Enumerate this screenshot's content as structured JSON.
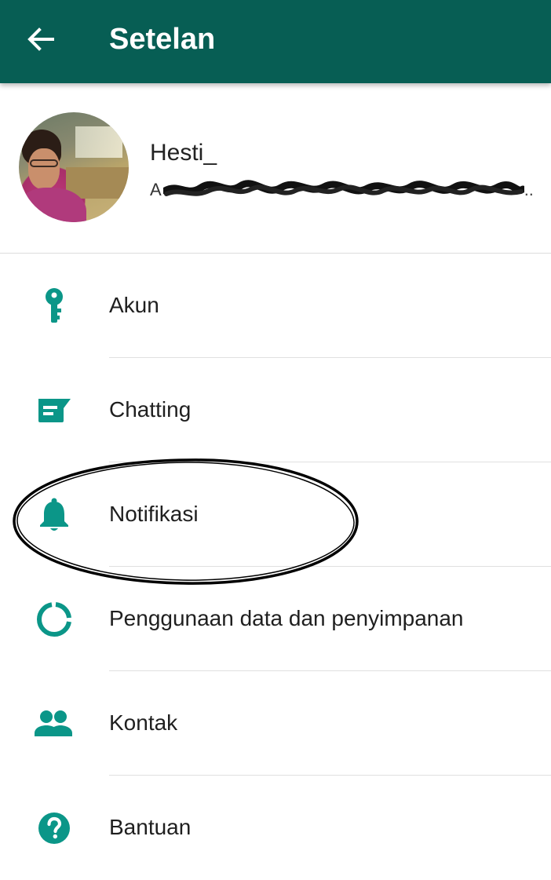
{
  "colors": {
    "app_bar": "#075e54",
    "icon_teal": "#0b9688",
    "divider": "#e0e0e0"
  },
  "app_bar": {
    "back_icon": "arrow-left-icon",
    "title": "Setelan"
  },
  "profile": {
    "name": "Hesti_",
    "status_visible_start": "A",
    "status_truncation": "..",
    "status_redacted": true
  },
  "menu": [
    {
      "label": "Akun",
      "icon": "key-icon"
    },
    {
      "label": "Chatting",
      "icon": "chat-icon"
    },
    {
      "label": "Notifikasi",
      "icon": "bell-icon"
    },
    {
      "label": "Penggunaan data dan penyimpanan",
      "icon": "data-usage-icon"
    },
    {
      "label": "Kontak",
      "icon": "contacts-icon"
    },
    {
      "label": "Bantuan",
      "icon": "help-icon"
    }
  ],
  "annotation": {
    "shape": "ellipse",
    "encircled_item": "Notifikasi"
  }
}
